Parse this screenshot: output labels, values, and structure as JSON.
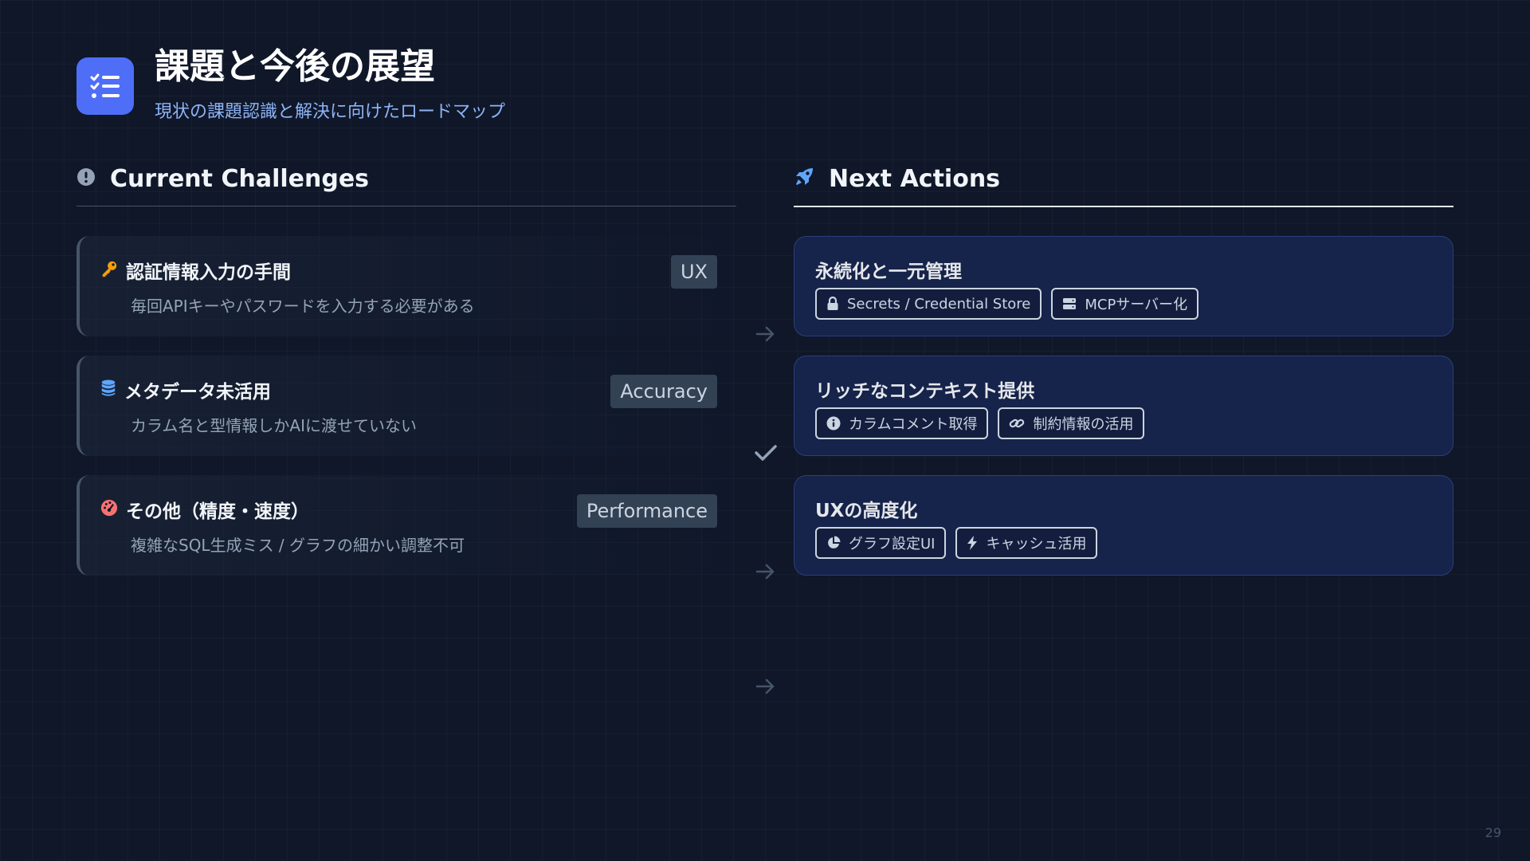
{
  "header": {
    "title": "課題と今後の展望",
    "subtitle": "現状の課題認識と解決に向けたロードマップ",
    "icon": "task-list-icon"
  },
  "left": {
    "heading": "Current Challenges",
    "icon": "exclamation-circle-icon",
    "items": [
      {
        "icon": "key-icon",
        "title": "認証情報入力の手間",
        "desc": "毎回APIキーやパスワードを入力する必要がある",
        "tag": "UX"
      },
      {
        "icon": "database-icon",
        "title": "メタデータ未活用",
        "desc": "カラム名と型情報しかAIに渡せていない",
        "tag": "Accuracy"
      },
      {
        "icon": "gauge-icon",
        "title": "その他（精度・速度）",
        "desc": "複雑なSQL生成ミス / グラフの細かい調整不可",
        "tag": "Performance"
      }
    ]
  },
  "right": {
    "heading": "Next Actions",
    "icon": "rocket-icon",
    "items": [
      {
        "title": "永続化と一元管理",
        "chips": [
          {
            "icon": "lock-icon",
            "label": "Secrets / Credential Store"
          },
          {
            "icon": "server-icon",
            "label": "MCPサーバー化"
          }
        ]
      },
      {
        "title": "リッチなコンテキスト提供",
        "chips": [
          {
            "icon": "info-icon",
            "label": "カラムコメント取得"
          },
          {
            "icon": "link-icon",
            "label": "制約情報の活用"
          }
        ]
      },
      {
        "title": "UXの高度化",
        "chips": [
          {
            "icon": "pie-chart-icon",
            "label": "グラフ設定UI"
          },
          {
            "icon": "bolt-icon",
            "label": "キャッシュ活用"
          }
        ]
      }
    ]
  },
  "colors": {
    "accent": "#4f6ef7",
    "key": "#f59e0b",
    "database": "#60a5fa",
    "gauge": "#f87171",
    "rocket": "#60a5fa"
  },
  "page_number": "29"
}
